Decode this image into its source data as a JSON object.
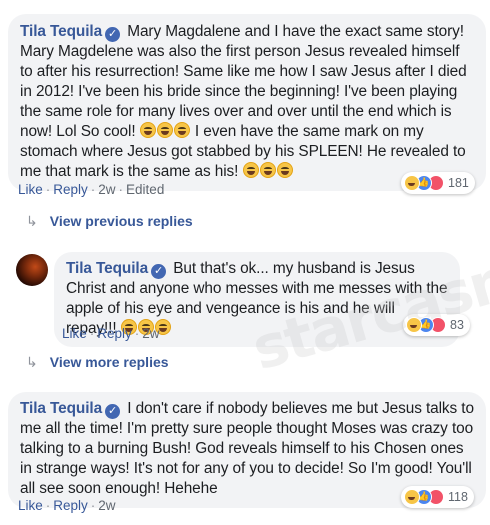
{
  "comments": [
    {
      "author": "Tila Tequila",
      "verified_glyph": "✓",
      "text_parts": [
        "Mary Magdalene and I have the exact same story! Mary Magdelene was also the first person Jesus revealed himself to after his resurrection! Same like me how I saw Jesus after I died in 2012! I've been his bride since the beginning! I've been playing the same role for many lives over and over until the end which is now! Lol So cool!",
        "I even have the same mark on my stomach where Jesus got stabbed by his SPLEEN! He revealed to me that mark is the same as his!"
      ],
      "like_label": "Like",
      "reply_label": "Reply",
      "time": "2w",
      "edited": "Edited",
      "reaction_count": "181"
    },
    {
      "author": "Tila Tequila",
      "verified_glyph": "✓",
      "text": "But that's ok... my husband is Jesus Christ and anyone who messes with me messes with the apple of his eye and vengeance is his and he will repay!!!",
      "like_label": "Like",
      "reply_label": "Reply",
      "time": "2w",
      "reaction_count": "83"
    },
    {
      "author": "Tila Tequila",
      "verified_glyph": "✓",
      "text": "I don't care if nobody believes me but Jesus talks to me all the time! I'm pretty sure people thought Moses was crazy too talking to a burning Bush! God reveals himself to his Chosen ones in strange ways! It's not for any of you to decide! So I'm good! You'll all see soon enough! Hehehe",
      "like_label": "Like",
      "reply_label": "Reply",
      "time": "2w",
      "reaction_count": "118"
    }
  ],
  "view_previous_replies": "View previous replies",
  "view_more_replies": "View more replies",
  "reply_arrow": "↳",
  "separator": "·",
  "icons": {
    "laugh": "laughing-emoji-icon",
    "haha": "haha-reaction-icon",
    "like": "like-reaction-icon",
    "wow": "wow-reaction-icon"
  },
  "watermark": "starcasm",
  "colors": {
    "author": "#385898",
    "bubble": "#f2f3f5",
    "meta": "#606770",
    "verified": "#4267b2"
  }
}
